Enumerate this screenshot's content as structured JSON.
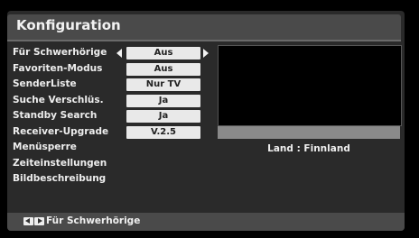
{
  "title": "Konfiguration",
  "menu": [
    {
      "label": "Für Schwerhörige",
      "value": "Aus"
    },
    {
      "label": "Favoriten-Modus",
      "value": "Aus"
    },
    {
      "label": "SenderListe",
      "value": "Nur TV"
    },
    {
      "label": "Suche Verschlüs.",
      "value": "Ja"
    },
    {
      "label": "Standby Search",
      "value": "Ja"
    },
    {
      "label": "Receiver-Upgrade",
      "value": "V.2.5"
    },
    {
      "label": "Menüsperre"
    },
    {
      "label": "Zeiteinstellungen"
    },
    {
      "label": "Bildbeschreibung"
    }
  ],
  "country_text": "Land : Finnland",
  "footer": {
    "hint": "Für Schwerhörige",
    "icons": [
      "left-arrow-key-icon",
      "right-arrow-key-icon"
    ]
  }
}
